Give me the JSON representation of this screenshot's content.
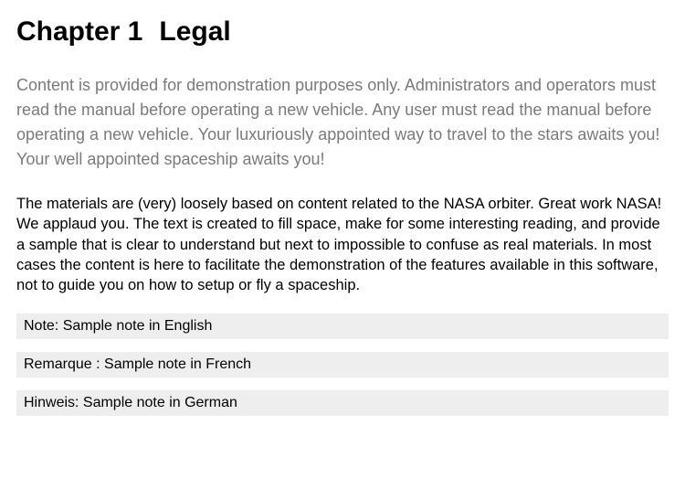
{
  "heading": {
    "chapter_label": "Chapter 1",
    "title": "Legal"
  },
  "intro": "Content is provided for demonstration purposes only. Administrators and operators must read the manual before operating a new vehicle. Any user must read the manual before operating a new vehicle. Your luxuriously appointed way to travel to the stars awaits you! Your well appointed spaceship awaits you!",
  "body": "The materials are (very) loosely based on content related to the NASA orbiter. Great work NASA! We applaud you. The text is created to fill space, make for some interesting reading, and provide a sample that is clear to understand but next to impossible to confuse as real materials. In most cases the content is here to facilitate the demonstration of the features available in this software, not to guide you on how to setup or fly a spaceship.",
  "notes": {
    "english": "Note: Sample note in English",
    "french": "Remarque : Sample note in French",
    "german": "Hinweis: Sample note in German"
  }
}
